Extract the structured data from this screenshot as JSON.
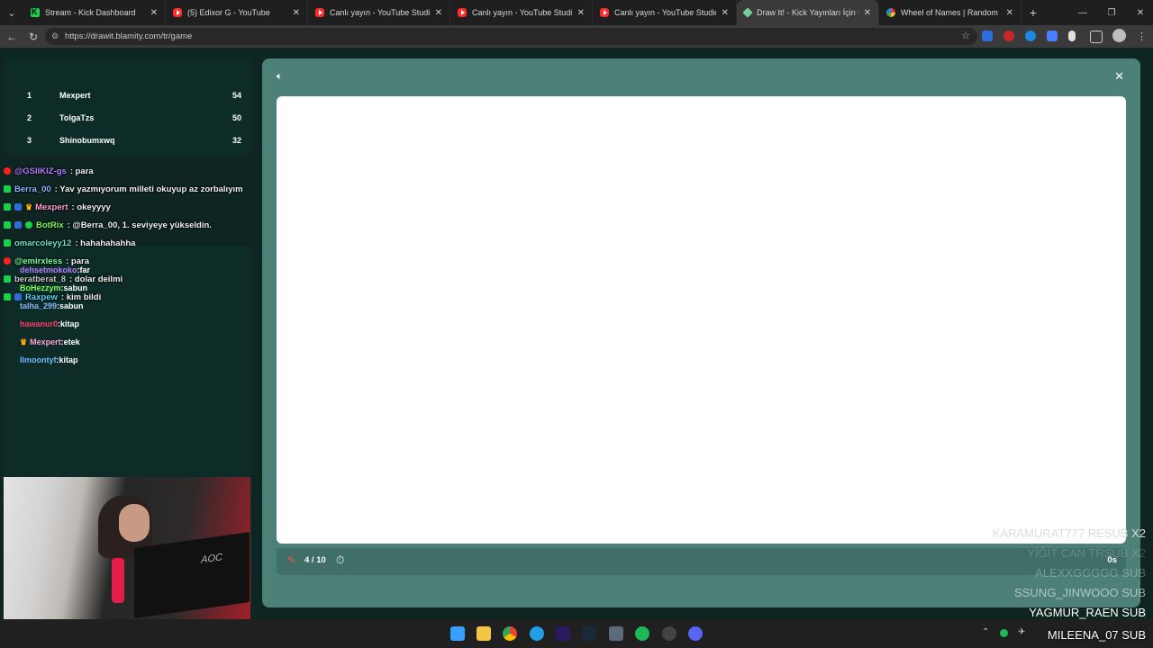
{
  "browser": {
    "tabs": [
      {
        "label": "Stream - Kick Dashboard",
        "icon": "kick-icon"
      },
      {
        "label": "(5) Edixor G - YouTube",
        "icon": "youtube-icon"
      },
      {
        "label": "Canlı yayın - YouTube Studio",
        "icon": "youtube-icon"
      },
      {
        "label": "Canlı yayın - YouTube Studio",
        "icon": "youtube-icon"
      },
      {
        "label": "Canlı yayın - YouTube Studio",
        "icon": "youtube-icon"
      },
      {
        "label": "Draw It! - Kick Yayınları İçin Çizim",
        "icon": "draw-it-icon"
      },
      {
        "label": "Wheel of Names | Random name",
        "icon": "wheel-icon"
      }
    ],
    "active_tab": 5,
    "url": "https://drawit.blamity.com/tr/game"
  },
  "leaderboard": [
    {
      "rank": "1",
      "name": "Mexpert",
      "score": "54"
    },
    {
      "rank": "2",
      "name": "TolgaTzs",
      "score": "50"
    },
    {
      "rank": "3",
      "name": "Shinobumxwq",
      "score": "32"
    }
  ],
  "chat": [
    {
      "user": "@GSlIKIZ-gs",
      "text": ": para",
      "color": "#b57bff",
      "badge": "youtube"
    },
    {
      "user": "Berra_00",
      "text": ": Yav yazmıyorum milleti okuyup az zorbalıyım",
      "color": "#8ab4ff",
      "badge": "kick"
    },
    {
      "user": "Mexpert",
      "text": ": okeyyyy",
      "color": "#ff9dd2",
      "badge": "kick"
    },
    {
      "user": "BotRix",
      "text": ": @Berra_00, 1. seviyeye yükseldin.",
      "color": "#7cff5a",
      "badge": "kick"
    },
    {
      "user": "omarcoleyy12",
      "text": ": hahahahahha",
      "color": "#6fe3c4",
      "badge": "kick"
    },
    {
      "user": "@emirxless",
      "text": ": para",
      "color": "#7cff9c",
      "badge": "youtube"
    },
    {
      "user": "beratberat_8",
      "text": ": dolar deilmi",
      "color": "#c7c7c7",
      "badge": "kick"
    },
    {
      "user": "Raxpew",
      "text": ": kim bildi",
      "color": "#5ad4ff",
      "badge": "kick"
    }
  ],
  "guesses": [
    {
      "user": "dehsetmokoko",
      "word": ":far",
      "color": "#b57bff"
    },
    {
      "user": "BoHezzym",
      "word": ":sabun",
      "color": "#7cff5a"
    },
    {
      "user": "talha_299",
      "word": ":sabun",
      "color": "#8ab4ff"
    },
    {
      "user": "hawanur0",
      "word": ":kitap",
      "color": "#ff3b6b"
    },
    {
      "user": "Mexpert",
      "word": ":etek",
      "color": "#ff9dd2"
    },
    {
      "user": "Ilmoontyf",
      "word": ":kitap",
      "color": "#6fb8ff"
    }
  ],
  "game": {
    "round": "4 / 10",
    "time_left": "0s"
  },
  "subs": [
    "KARAMURAT777  RESUB X2",
    "YİĞİT CAN  TRSUB X2",
    "ALEXXGGGGG  SUB",
    "SSUNG_JINWOOO  SUB",
    "YAGMUR_RAEN  SUB",
    "MILEENA_07  SUB"
  ]
}
